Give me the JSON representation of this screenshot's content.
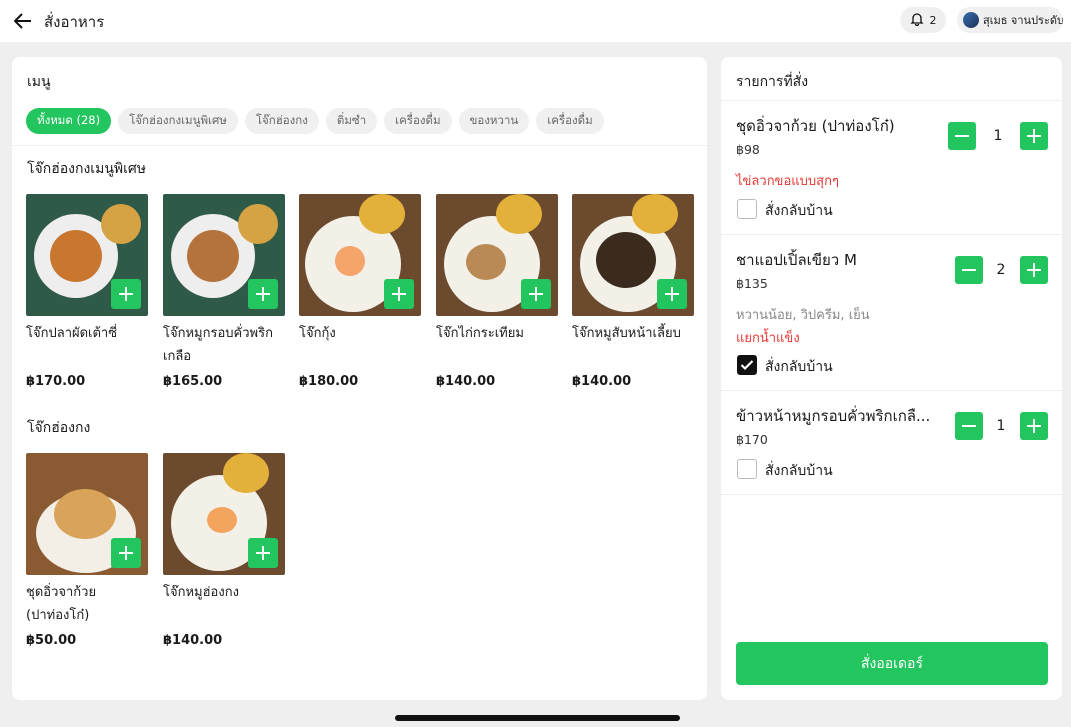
{
  "header": {
    "title": "สั่งอาหาร",
    "notifications": "2",
    "user_name": "สุเมธ จานประดับ"
  },
  "menu": {
    "title": "เมนู",
    "tabs": [
      "ทั้งหมด (28)",
      "โจ๊กฮ่องกงเมนูพิเศษ",
      "โจ๊กฮ่องกง",
      "ติ่มซำ",
      "เครื่องดื่ม",
      "ของหวาน",
      "เครื่องดื่ม"
    ],
    "sections": [
      {
        "title": "โจ๊กฮ่องกงเมนูพิเศษ",
        "items": [
          {
            "name": "โจ๊กปลาผัดเต้าซี่",
            "price": "฿170.00"
          },
          {
            "name": "โจ๊กหมูกรอบคั่วพริกเกลือ",
            "price": "฿165.00"
          },
          {
            "name": "โจ๊กกุ้ง",
            "price": "฿180.00"
          },
          {
            "name": "โจ๊กไก่กระเทียม",
            "price": "฿140.00"
          },
          {
            "name": "โจ๊กหมูสับหน้าเลี้ยบ",
            "price": "฿140.00"
          }
        ]
      },
      {
        "title": "โจ๊กฮ่องกง",
        "items": [
          {
            "name": "ชุดอิ่วจาก้วย (ปาท่องโก๋)",
            "price": "฿50.00"
          },
          {
            "name": "โจ๊กหมูฮ่องกง",
            "price": "฿140.00"
          }
        ]
      }
    ]
  },
  "order": {
    "title": "รายการที่สั่ง",
    "items": [
      {
        "name": "ชุดอิ่วจาก้วย (ปาท่องโก๋)",
        "price": "฿98",
        "qty": "1",
        "notes": "",
        "red_note": "ไข่ลวกขอแบบสุกๆ",
        "takeaway_label": "สั่งกลับบ้าน",
        "takeaway": false
      },
      {
        "name": "ชาแอปเปิ้ลเขียว M",
        "price": "฿135",
        "qty": "2",
        "notes": "หวานน้อย, วิปครีม, เย็น",
        "red_note": "แยกน้ำแข็ง",
        "takeaway_label": "สั่งกลับบ้าน",
        "takeaway": true
      },
      {
        "name": "ข้าวหน้าหมูกรอบคั่วพริกเกลื...",
        "price": "฿170",
        "qty": "1",
        "notes": "",
        "red_note": "",
        "takeaway_label": "สั่งกลับบ้าน",
        "takeaway": false
      }
    ],
    "submit_label": "สั่งออเดอร์"
  },
  "colors": {
    "accent": "#22c55e",
    "danger": "#e53935"
  }
}
